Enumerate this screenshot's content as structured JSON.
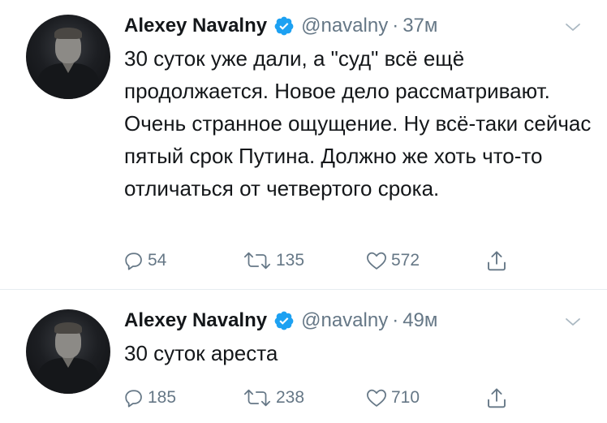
{
  "tweets": [
    {
      "name": "Alexey Navalny",
      "handle": "@navalny",
      "separator": "·",
      "time": "37м",
      "text": "30 суток уже дали, а \"суд\" всё ещё продолжается. Новое дело рассматривают. Очень странное ощущение. Ну всё-таки сейчас пятый срок Путина. Должно же хоть что-то отличаться от четвертого срока.",
      "replies": "54",
      "retweets": "135",
      "likes": "572"
    },
    {
      "name": "Alexey Navalny",
      "handle": "@navalny",
      "separator": "·",
      "time": "49м",
      "text": "30 суток ареста",
      "replies": "185",
      "retweets": "238",
      "likes": "710"
    }
  ],
  "colors": {
    "text": "#14171a",
    "secondary": "#657786",
    "verified": "#1da1f2",
    "divider": "#e6ecf0"
  },
  "icons": [
    "verified-badge-icon",
    "chevron-down-icon",
    "reply-icon",
    "retweet-icon",
    "like-icon",
    "share-icon"
  ]
}
